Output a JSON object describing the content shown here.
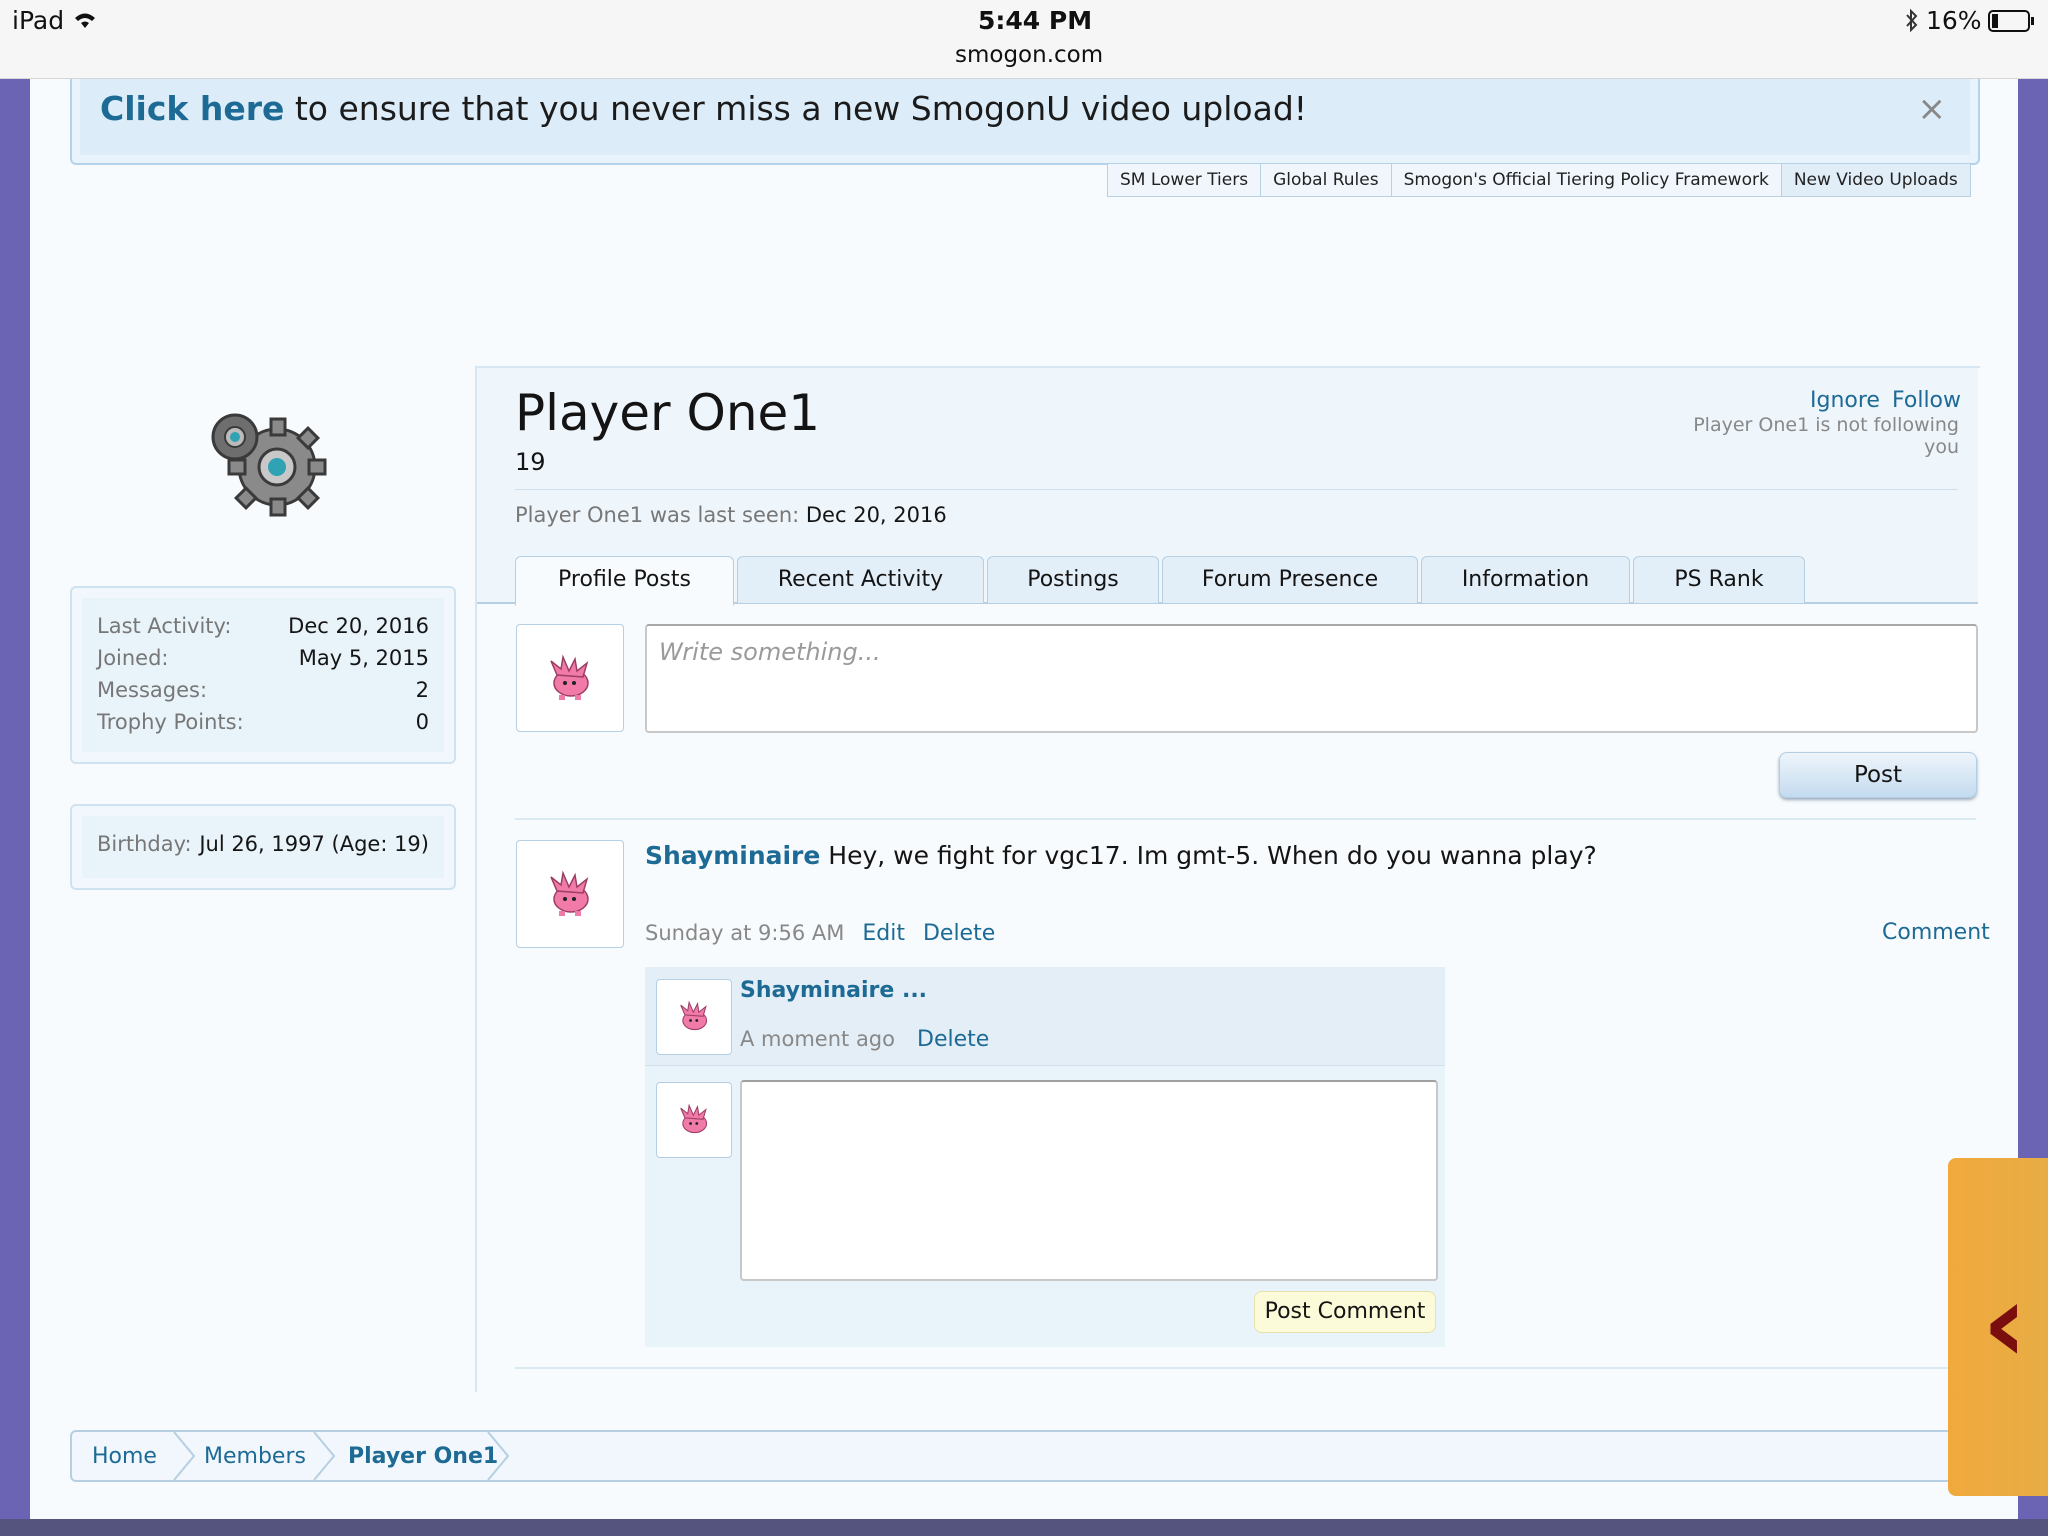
{
  "statusbar": {
    "device": "iPad",
    "time": "5:44 PM",
    "url": "smogon.com",
    "battery": "16%"
  },
  "notice": {
    "link": "Click here",
    "text": " to ensure that you never miss a new SmogonU video upload!",
    "close": "×"
  },
  "subnav": {
    "tabs": [
      "SM Lower Tiers",
      "Global Rules",
      "Smogon's Official Tiering Policy Framework",
      "New Video Uploads"
    ]
  },
  "sidebar": {
    "stats": [
      {
        "label": "Last Activity:",
        "value": "Dec 20, 2016"
      },
      {
        "label": "Joined:",
        "value": "May 5, 2015"
      },
      {
        "label": "Messages:",
        "value": "2"
      },
      {
        "label": "Trophy Points:",
        "value": "0"
      }
    ],
    "birthday": {
      "label": "Birthday:",
      "value": "Jul 26, 1997 (Age: 19)"
    }
  },
  "profile": {
    "username": "Player One1",
    "title": "19",
    "ignore": "Ignore",
    "follow": "Follow",
    "follow_note": "Player One1 is not following you",
    "last_seen_label": "Player One1 was last seen:",
    "last_seen_value": "Dec 20, 2016",
    "tabs": [
      "Profile Posts",
      "Recent Activity",
      "Postings",
      "Forum Presence",
      "Information",
      "PS Rank"
    ]
  },
  "composer": {
    "placeholder": "Write something...",
    "post_label": "Post"
  },
  "message": {
    "user": "Shayminaire",
    "text": "Hey, we fight for vgc17. Im gmt-5. When do you wanna play?",
    "time": "Sunday at 9:56 AM",
    "edit": "Edit",
    "delete": "Delete",
    "comment": "Comment"
  },
  "comment1": {
    "user": "Shayminaire ...",
    "time": "A moment ago",
    "delete": "Delete"
  },
  "comment_form": {
    "button": "Post Comment"
  },
  "breadcrumb": [
    "Home",
    "Members",
    "Player One1"
  ],
  "colors": {
    "accent": "#1d6a95",
    "side_tab": "#f1a93c"
  }
}
